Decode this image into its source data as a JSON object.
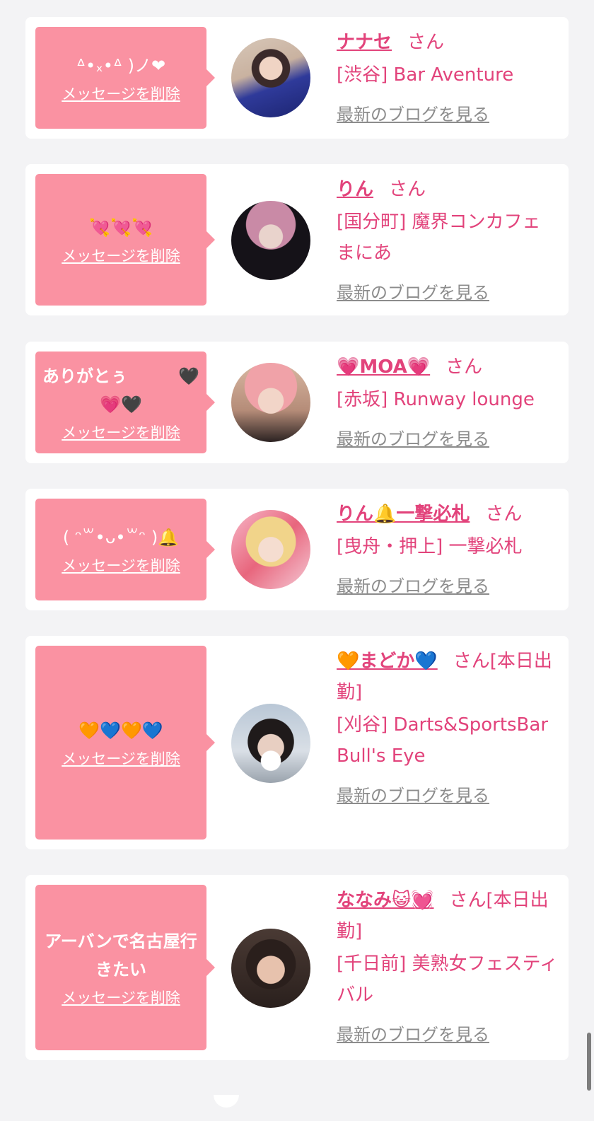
{
  "theme": {
    "bubble_color": "#fa92a2",
    "name_color": "#e2437b",
    "link_color": "#8c8c8c"
  },
  "cards": [
    {
      "message": "ᐞ•ₓ•ᐞ )ノ❤",
      "delete_label": "メッセージを削除",
      "name": "ナナセ",
      "honorific": "さん",
      "shop": "[渋谷] Bar Aventure",
      "blog_label": "最新のブログを見る"
    },
    {
      "message": "💘💘💘",
      "delete_label": "メッセージを削除",
      "name": "りん",
      "honorific": "さん",
      "shop": "[国分町] 魔界コンカフェ まにあ",
      "blog_label": "最新のブログを見る"
    },
    {
      "message": "ありがとぅ　　　🖤\n💗🖤",
      "delete_label": "メッセージを削除",
      "name": "💗MOA💗",
      "honorific": "さん",
      "shop": "[赤坂] Runway lounge",
      "blog_label": "最新のブログを見る"
    },
    {
      "message": "( ᵔ꒳•ᴗ•꒳ᵔ )🔔",
      "delete_label": "メッセージを削除",
      "name": "りん🔔一撃必札",
      "honorific": "さん",
      "shop": "[曳舟・押上] 一撃必札",
      "blog_label": "最新のブログを見る"
    },
    {
      "message": "🧡💙🧡💙",
      "delete_label": "メッセージを削除",
      "name": "🧡まどか💙",
      "honorific": "さん[本日出勤]",
      "shop": "[刈谷] Darts&SportsBar Bull's Eye",
      "blog_label": "最新のブログを見る"
    },
    {
      "message": "アーバンで名古屋行きたい",
      "delete_label": "メッセージを削除",
      "name": "ななみ😺💓",
      "honorific": "さん[本日出勤]",
      "shop": "[千日前] 美熟女フェスティバル",
      "blog_label": "最新のブログを見る"
    }
  ]
}
